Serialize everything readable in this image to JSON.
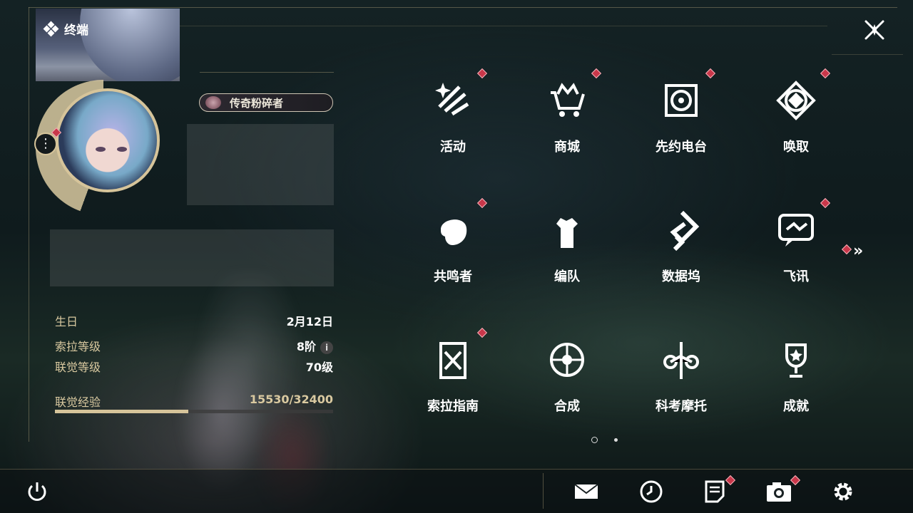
{
  "header": {
    "title": "终端",
    "close_icon": "close-icon"
  },
  "profile": {
    "title_badge": "传奇粉碎者",
    "birthday_label": "生日",
    "birthday_value": "2月12日",
    "sola_level_label": "索拉等级",
    "sola_level_value": "8阶",
    "union_level_label": "联觉等级",
    "union_level_value": "70级",
    "union_exp_label": "联觉经验",
    "union_exp_value": "15530/32400",
    "union_exp_progress": 0.479
  },
  "menu": {
    "items": [
      {
        "label": "活动",
        "icon": "activity-icon",
        "badge": true
      },
      {
        "label": "商城",
        "icon": "shop-icon",
        "badge": true
      },
      {
        "label": "先约电台",
        "icon": "radio-icon",
        "badge": true
      },
      {
        "label": "唤取",
        "icon": "convene-icon",
        "badge": true
      },
      {
        "label": "共鸣者",
        "icon": "resonator-icon",
        "badge": true
      },
      {
        "label": "编队",
        "icon": "team-icon",
        "badge": false
      },
      {
        "label": "数据坞",
        "icon": "data-bank-icon",
        "badge": false
      },
      {
        "label": "飞讯",
        "icon": "message-icon",
        "badge": true
      },
      {
        "label": "索拉指南",
        "icon": "guide-icon",
        "badge": true
      },
      {
        "label": "合成",
        "icon": "synthesis-icon",
        "badge": false
      },
      {
        "label": "科考摩托",
        "icon": "motorcycle-icon",
        "badge": false
      },
      {
        "label": "成就",
        "icon": "trophy-icon",
        "badge": false
      }
    ],
    "page_count": 2,
    "current_page": 1
  },
  "bottom_bar": [
    "power-icon",
    "mail-icon",
    "clock-icon",
    "notes-icon",
    "camera-icon",
    "settings-icon"
  ],
  "colors": {
    "accent": "#d6c49a",
    "badge": "#c9374a",
    "text": "#ffffff"
  }
}
